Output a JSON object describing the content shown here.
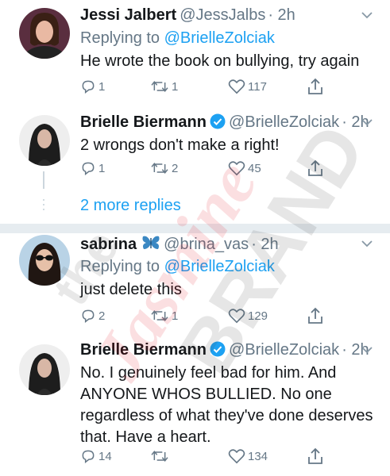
{
  "tweets": [
    {
      "name": "Jessi Jalbert",
      "handle": "@JessJalbs",
      "time": "· 2h",
      "replying_prefix": "Replying to",
      "replying_to": "@BrielleZolciak",
      "text": "He wrote the book on bullying, try again",
      "replies": "1",
      "retweets": "1",
      "likes": "117"
    },
    {
      "name": "Brielle Biermann",
      "handle": "@BrielleZolciak",
      "time": "· 2h",
      "text": "2 wrongs don't make a right!",
      "replies": "1",
      "retweets": "2",
      "likes": "45"
    },
    {
      "name": "sabrina",
      "handle": "@brina_vas",
      "time": "· 2h",
      "replying_prefix": "Replying to",
      "replying_to": "@BrielleZolciak",
      "text": "just delete this",
      "replies": "2",
      "retweets": "1",
      "likes": "129"
    },
    {
      "name": "Brielle Biermann",
      "handle": "@BrielleZolciak",
      "time": "· 2h",
      "text": "No. I genuinely feel bad for him. And ANYONE WHOS BULLIED. No one regardless of what they've done deserves that. Have a heart.",
      "replies": "14",
      "retweets": "",
      "likes": "134"
    }
  ],
  "more_replies": "2 more replies",
  "watermark": {
    "top": "the",
    "middle": "Jasmine",
    "bottom": "BRAND"
  },
  "colors": {
    "link": "#1da1f2",
    "secondary": "#657786",
    "divider": "#e6ecf0",
    "verified": "#1da1f2"
  },
  "icons": [
    "reply-icon",
    "retweet-icon",
    "like-icon",
    "share-icon",
    "chevron-down-icon",
    "verified-badge-icon",
    "butterfly-emoji-icon"
  ]
}
